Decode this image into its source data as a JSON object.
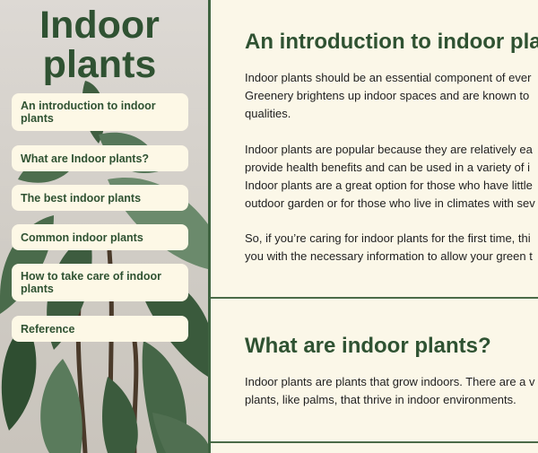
{
  "sidebar": {
    "title": "Indoor\nplants",
    "nav": [
      {
        "label": "An introduction to indoor plants"
      },
      {
        "label": "What are Indoor plants?"
      },
      {
        "label": "The best indoor plants"
      },
      {
        "label": "Common indoor plants"
      },
      {
        "label": "How to take care of indoor plants"
      },
      {
        "label": "Reference"
      }
    ]
  },
  "main": {
    "intro": {
      "heading": "An introduction to indoor pla",
      "paragraphs": [
        [
          "Indoor plants should be an essential component of ever",
          "Greenery brightens up indoor spaces and are known to",
          "qualities."
        ],
        [
          "Indoor plants are popular because they are relatively ea",
          "provide health benefits and can be used in a variety of i",
          "Indoor plants are a great option for those who have little",
          "outdoor garden or for those who live in climates with sev"
        ],
        [
          "So, if you’re caring for indoor plants for the first time, thi",
          "you with the necessary information to allow your green t"
        ]
      ]
    },
    "what": {
      "heading": "What are indoor plants?",
      "paragraphs": [
        [
          "Indoor plants are plants that grow indoors. There are a v",
          "plants, like palms, that thrive in indoor environments."
        ]
      ]
    }
  },
  "colors": {
    "accent": "#2f5232",
    "background": "#fbf7e8",
    "button_bg": "#fdf8e6"
  }
}
